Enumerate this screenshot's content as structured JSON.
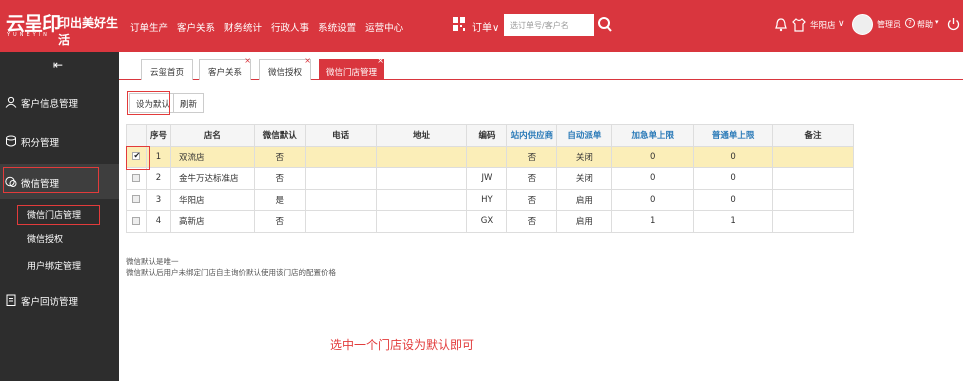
{
  "brand": {
    "logo_text": "云呈印",
    "logo_sub": "YUNEYIN",
    "slogan": "印出美好生活"
  },
  "topnav": [
    "订单生产",
    "客户关系",
    "财务统计",
    "行政人事",
    "系统设置",
    "运营中心"
  ],
  "order_select": "订单",
  "search": {
    "placeholder": "选订单号/客户名"
  },
  "user": {
    "store": "华阳店",
    "name": "管理员",
    "help": "帮助"
  },
  "colors": {
    "brand_red": "#d9363e",
    "sidebar_bg": "#2d2d2d",
    "selected_row": "#fbeeb8",
    "link_blue": "#2a7ab8"
  },
  "sidebar": {
    "items": [
      "客户信息管理",
      "积分管理",
      "微信管理",
      "客户回访管理"
    ],
    "subitems": [
      "微信门店管理",
      "微信授权",
      "用户绑定管理"
    ]
  },
  "tabs": [
    "云玺首页",
    "客户关系",
    "微信授权",
    "微信门店管理"
  ],
  "buttons": {
    "set_default": "设为默认",
    "refresh": "刷新"
  },
  "table": {
    "headers": [
      "序号",
      "店名",
      "微信默认",
      "电话",
      "地址",
      "编码",
      "站内供应商",
      "自动派单",
      "加急单上限",
      "普通单上限",
      "备注"
    ],
    "rows": [
      {
        "no": "1",
        "name": "双流店",
        "default": "否",
        "phone": "",
        "address": "",
        "code": "",
        "supplier": "否",
        "auto": "关闭",
        "urgent": "0",
        "normal": "0",
        "remark": "",
        "checked": true
      },
      {
        "no": "2",
        "name": "金牛万达标准店",
        "default": "否",
        "phone": "",
        "address": "",
        "code": "JW",
        "supplier": "否",
        "auto": "关闭",
        "urgent": "0",
        "normal": "0",
        "remark": "",
        "checked": false
      },
      {
        "no": "3",
        "name": "华阳店",
        "default": "是",
        "phone": "",
        "address": "",
        "code": "HY",
        "supplier": "否",
        "auto": "启用",
        "urgent": "0",
        "normal": "0",
        "remark": "",
        "checked": false
      },
      {
        "no": "4",
        "name": "高新店",
        "default": "否",
        "phone": "",
        "address": "",
        "code": "GX",
        "supplier": "否",
        "auto": "启用",
        "urgent": "1",
        "normal": "1",
        "remark": "",
        "checked": false
      }
    ]
  },
  "notes": [
    "微信默认是唯一",
    "微信默认后用户未绑定门店自主询价默认使用该门店的配置价格"
  ],
  "hint": "选中一个门店设为默认即可"
}
